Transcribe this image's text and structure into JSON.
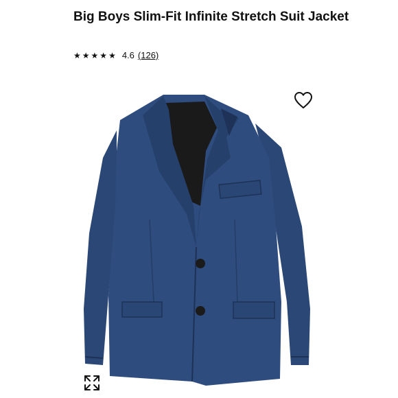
{
  "product": {
    "title": "Big Boys Slim-Fit Infinite Stretch Suit Jacket",
    "rating": {
      "stars_filled": 5,
      "star_glyph": "★",
      "value": "4.6",
      "reviews": "(126)"
    }
  },
  "icons": {
    "favorite": "heart-outline-icon",
    "expand": "expand-arrows-icon"
  },
  "colors": {
    "jacket": "#2b4775",
    "jacket_dark": "#1d3256",
    "lining": "#1a1a1a",
    "text": "#111111"
  }
}
